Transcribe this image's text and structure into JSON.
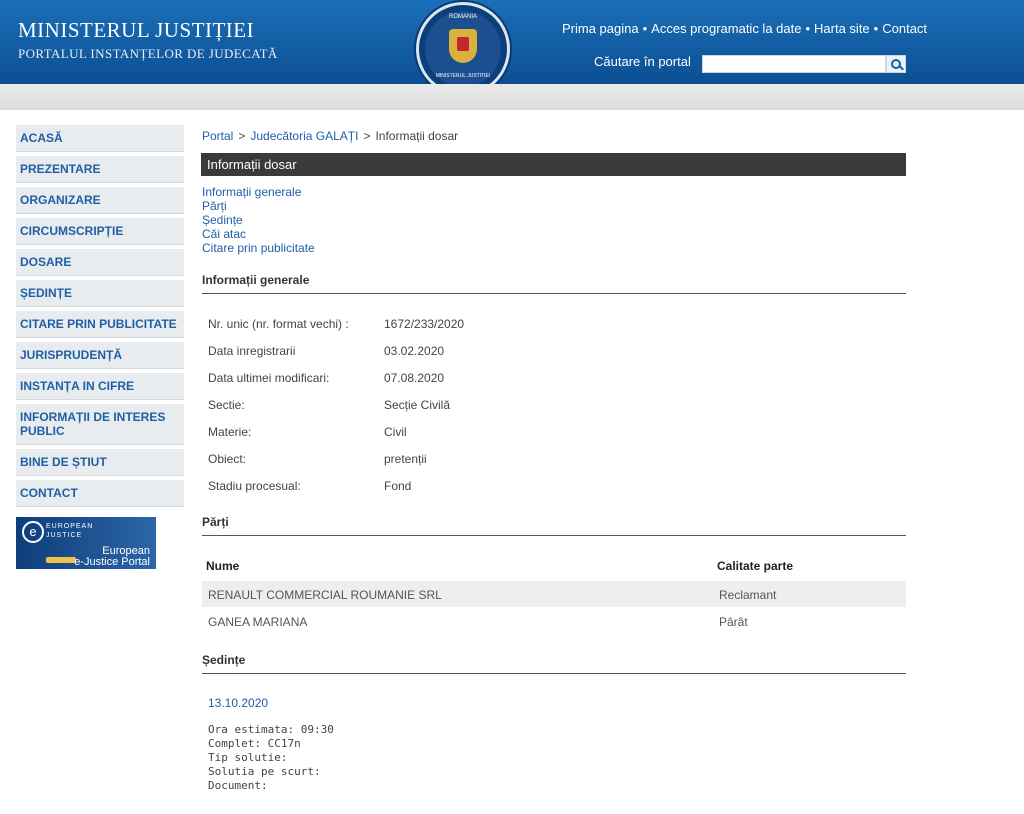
{
  "header": {
    "title": "MINISTERUL JUSTIȚIEI",
    "subtitle": "PORTALUL INSTANȚELOR DE JUDECATĂ",
    "emblem_top": "ROMANIA",
    "emblem_bottom": "MINISTERUL JUSTITIEI",
    "nav": [
      "Prima pagina",
      "Acces programatic la date",
      "Harta site",
      "Contact"
    ],
    "search_label": "Căutare în portal"
  },
  "sidebar": {
    "items": [
      "ACASĂ",
      "PREZENTARE",
      "ORGANIZARE",
      "CIRCUMSCRIPȚIE",
      "DOSARE",
      "ȘEDINȚE",
      "CITARE PRIN PUBLICITATE",
      "JURISPRUDENȚĂ",
      "INSTANȚA IN CIFRE",
      "INFORMAȚII DE INTERES PUBLIC",
      "BINE DE ȘTIUT",
      "CONTACT"
    ],
    "ejustice": {
      "line1": "EUROPEAN",
      "line2": "JUSTICE",
      "line3": "European",
      "line4": "e-Justice Portal"
    }
  },
  "breadcrumb": {
    "items": [
      "Portal",
      "Judecătoria GALAȚI",
      "Informații dosar"
    ],
    "sep": ">"
  },
  "bar_title": "Informații dosar",
  "links": [
    "Informații generale",
    "Părți",
    "Ședințe",
    "Căi atac",
    "Citare prin publicitate"
  ],
  "general": {
    "heading": "Informații generale",
    "rows": [
      {
        "label": "Nr. unic (nr. format vechi) :",
        "value": "1672/233/2020"
      },
      {
        "label": "Data inregistrarii",
        "value": "03.02.2020"
      },
      {
        "label": "Data ultimei modificari:",
        "value": "07.08.2020"
      },
      {
        "label": "Sectie:",
        "value": "Secție Civilă"
      },
      {
        "label": "Materie:",
        "value": "Civil"
      },
      {
        "label": "Obiect:",
        "value": "pretenții"
      },
      {
        "label": "Stadiu procesual:",
        "value": "Fond"
      }
    ]
  },
  "parti": {
    "heading": "Părți",
    "col_name": "Nume",
    "col_role": "Calitate parte",
    "rows": [
      {
        "name": "RENAULT COMMERCIAL ROUMANIE SRL",
        "role": "Reclamant"
      },
      {
        "name": "GANEA MARIANA",
        "role": "Pârât"
      }
    ]
  },
  "sedinte": {
    "heading": "Ședințe",
    "date": "13.10.2020",
    "details": [
      "Ora estimata: 09:30",
      "Complet: CC17n",
      "Tip solutie:",
      "Solutia pe scurt:",
      "Document:"
    ]
  },
  "colors": {
    "header_blue": "#1a6fb8",
    "link_blue": "#1f5fa6",
    "dark_bar": "#3a3a3a"
  }
}
